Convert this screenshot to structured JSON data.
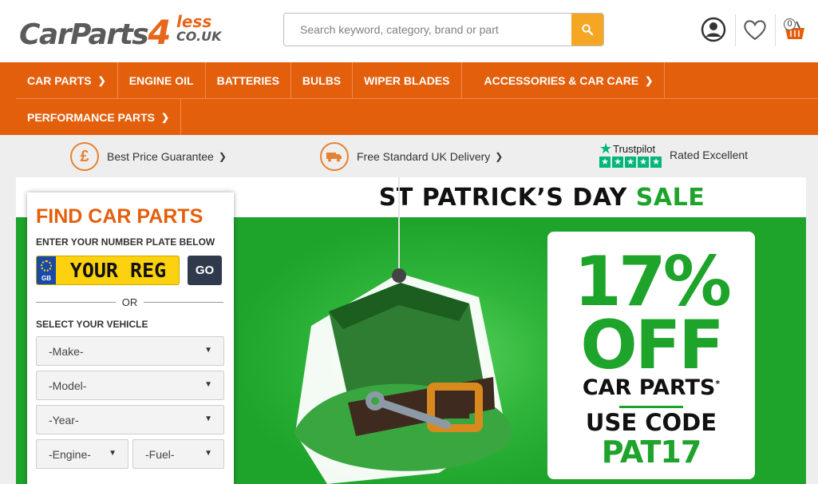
{
  "header": {
    "logo": {
      "main": "CarParts",
      "four": "4",
      "less": "less",
      "couk": "CO.UK"
    },
    "search": {
      "placeholder": "Search keyword, category, brand or part"
    },
    "basket_count": "0"
  },
  "nav": {
    "row1": [
      {
        "label": "CAR PARTS",
        "chevron": true
      },
      {
        "label": "ENGINE OIL",
        "chevron": false
      },
      {
        "label": "BATTERIES",
        "chevron": false
      },
      {
        "label": "BULBS",
        "chevron": false
      },
      {
        "label": "WIPER BLADES",
        "chevron": false
      },
      {
        "label": "ACCESSORIES & CAR CARE",
        "chevron": true
      }
    ],
    "row2": [
      {
        "label": "PERFORMANCE PARTS",
        "chevron": true
      }
    ]
  },
  "usp": {
    "price": "Best Price Guarantee",
    "delivery": "Free Standard UK Delivery",
    "trustpilot_brand": "Trustpilot",
    "rating": "Rated Excellent"
  },
  "banner": {
    "headline_black": "ST PATRICK’S DAY",
    "headline_green": "SALE",
    "discount": "17%",
    "off": "OFF",
    "category": "CAR PARTS",
    "asterisk": "*",
    "use_code": "USE CODE",
    "code": "PAT17"
  },
  "finder": {
    "title": "FIND CAR PARTS",
    "plate_label": "ENTER YOUR NUMBER PLATE BELOW",
    "plate_country": "GB",
    "plate_placeholder": "YOUR REG",
    "go": "GO",
    "or": "OR",
    "select_label": "SELECT YOUR VEHICLE",
    "make": "-Make-",
    "model": "-Model-",
    "year": "-Year-",
    "engine": "-Engine-",
    "fuel": "-Fuel-"
  },
  "colors": {
    "brand_orange": "#e35f0c",
    "search_button": "#f5a623",
    "banner_green": "#1ea32b",
    "trustpilot_green": "#00b67a",
    "plate_yellow": "#fcd20e",
    "go_button": "#2f3b4c"
  }
}
